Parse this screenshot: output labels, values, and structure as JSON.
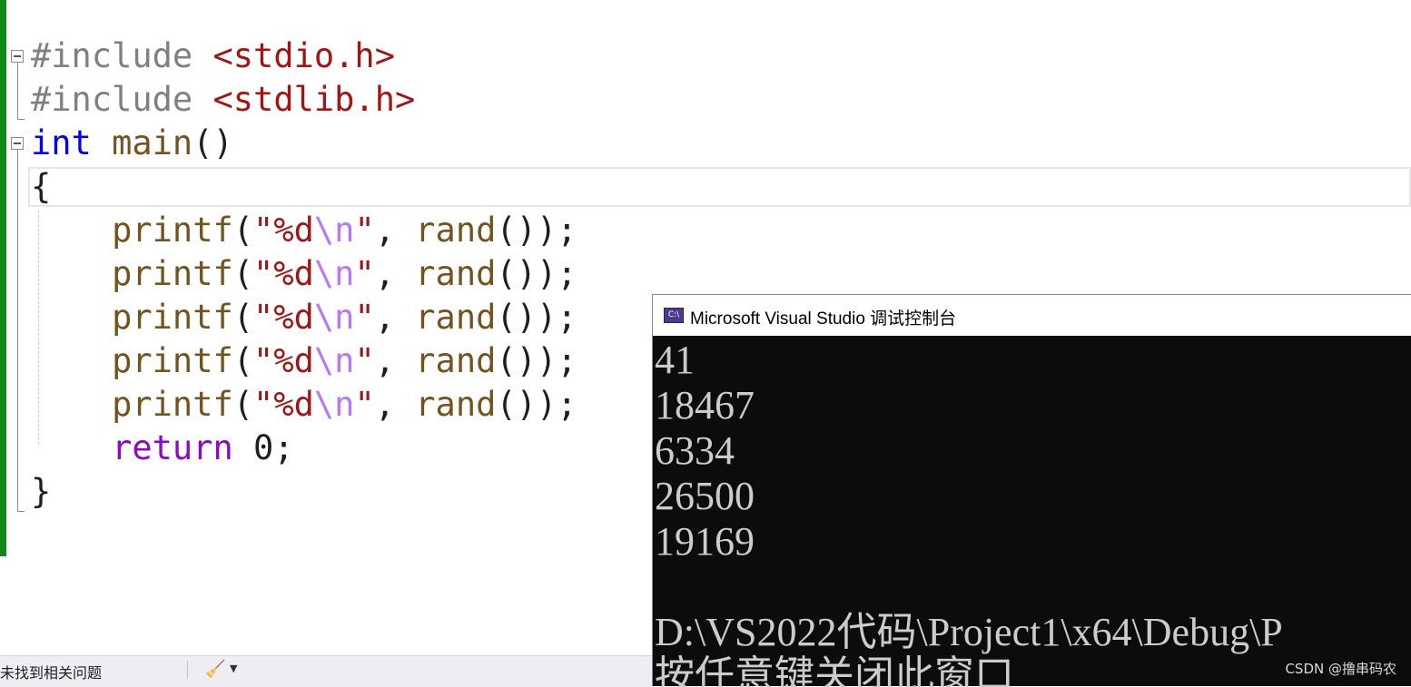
{
  "editor": {
    "lines": [
      {
        "pp": "#include",
        "inc": "<stdio.h>"
      },
      {
        "pp": "#include",
        "inc": "<stdlib.h>"
      },
      {
        "type": "int",
        "name": "main",
        "paren": "()"
      },
      {
        "brace": "{"
      },
      {
        "fn": "printf",
        "open": "(",
        "str1": "\"%d",
        "esc": "\\n",
        "str2": "\"",
        "comma": ", ",
        "call": "rand",
        "rest": "());"
      },
      {
        "fn": "printf",
        "open": "(",
        "str1": "\"%d",
        "esc": "\\n",
        "str2": "\"",
        "comma": ", ",
        "call": "rand",
        "rest": "());"
      },
      {
        "fn": "printf",
        "open": "(",
        "str1": "\"%d",
        "esc": "\\n",
        "str2": "\"",
        "comma": ", ",
        "call": "rand",
        "rest": "());"
      },
      {
        "fn": "printf",
        "open": "(",
        "str1": "\"%d",
        "esc": "\\n",
        "str2": "\"",
        "comma": ", ",
        "call": "rand",
        "rest": "());"
      },
      {
        "fn": "printf",
        "open": "(",
        "str1": "\"%d",
        "esc": "\\n",
        "str2": "\"",
        "comma": ", ",
        "call": "rand",
        "rest": "());"
      },
      {
        "kw": "return",
        "num": "0",
        "semi": ";"
      },
      {
        "brace": "}"
      }
    ]
  },
  "status_bar": {
    "issues_text": "未找到相关问题",
    "dropdown_glyph": "▼",
    "broom_glyph": "🧹"
  },
  "console": {
    "title": "Microsoft Visual Studio 调试控制台",
    "icon_text": "C:\\",
    "output": [
      "41",
      "18467",
      "6334",
      "26500",
      "19169",
      "",
      "D:\\VS2022代码\\Project1\\x64\\Debug\\P",
      "按任意键关闭此窗口"
    ]
  },
  "watermark": "CSDN @撸串码农"
}
